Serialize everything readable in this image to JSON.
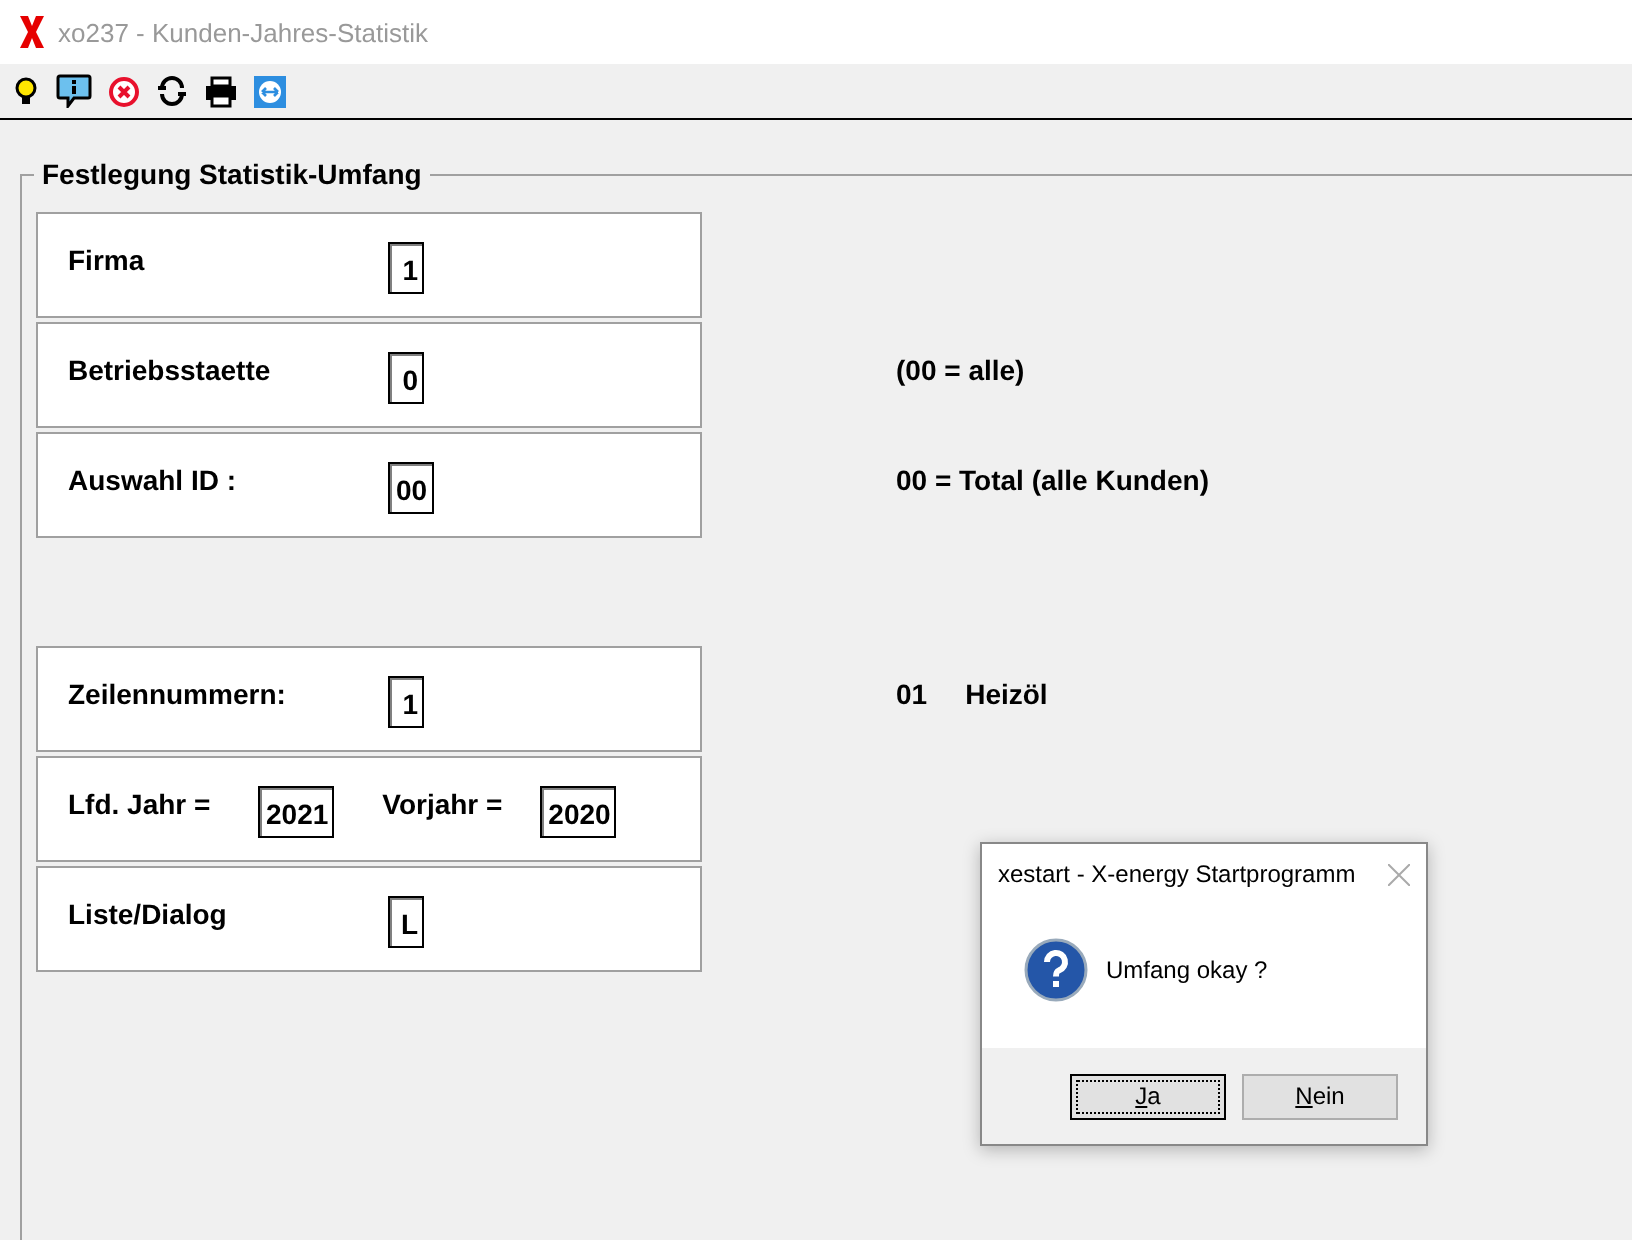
{
  "window": {
    "title": "xo237 - Kunden-Jahres-Statistik"
  },
  "toolbar": [
    {
      "kind": "bulb"
    },
    {
      "kind": "info"
    },
    {
      "kind": "cancel"
    },
    {
      "kind": "refresh"
    },
    {
      "kind": "print"
    },
    {
      "kind": "remote"
    }
  ],
  "group": {
    "title": "Festlegung Statistik-Umfang",
    "sections": [
      [
        {
          "fields": [
            {
              "label": "Firma",
              "value": "1"
            }
          ]
        },
        {
          "fields": [
            {
              "label": "Betriebsstaette",
              "value": "0"
            }
          ],
          "notes": [
            "(00 = alle)"
          ]
        },
        {
          "fields": [
            {
              "label": "Auswahl ID :",
              "value": "00"
            }
          ],
          "notes": [
            "00 = Total (alle Kunden)"
          ]
        }
      ],
      [
        {
          "fields": [
            {
              "label": "Zeilennummern:",
              "value": "1"
            }
          ],
          "notes": [
            "01",
            "Heizöl"
          ]
        },
        {
          "fields": [
            {
              "label": "Lfd. Jahr =",
              "value": "2021"
            },
            {
              "label": "Vorjahr =",
              "value": "2020"
            }
          ]
        },
        {
          "fields": [
            {
              "label": "Liste/Dialog",
              "value": "L"
            }
          ]
        }
      ]
    ]
  },
  "dialog": {
    "title": "xestart - X-energy Startprogramm",
    "message": "Umfang okay ?",
    "buttons": [
      {
        "label": "Ja",
        "focused": true
      },
      {
        "label": "Nein",
        "focused": false
      }
    ]
  }
}
